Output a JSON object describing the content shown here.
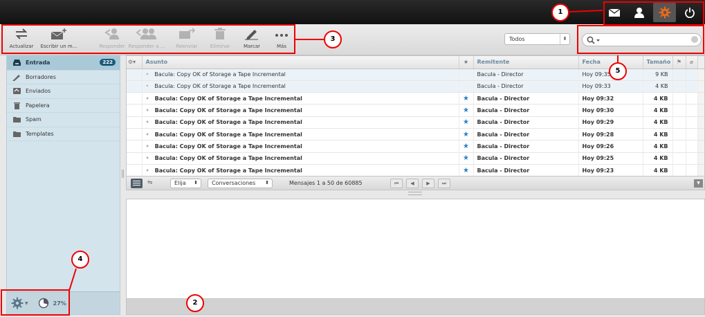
{
  "toolbar": {
    "buttons": [
      {
        "label": "Actualizar",
        "icon": "refresh-icon"
      },
      {
        "label": "Escribir un m...",
        "icon": "compose-icon"
      },
      {
        "label": "Responder",
        "icon": "reply-icon"
      },
      {
        "label": "Responder a ...",
        "icon": "reply-all-icon"
      },
      {
        "label": "Reenviar",
        "icon": "forward-icon"
      },
      {
        "label": "Eliminar",
        "icon": "trash-icon"
      },
      {
        "label": "Marcar",
        "icon": "pencil-icon"
      },
      {
        "label": "Más",
        "icon": "more-icon"
      }
    ],
    "filter_value": "Todos",
    "search_placeholder": ""
  },
  "sidebar": {
    "folders": [
      {
        "label": "Entrada",
        "icon": "inbox-icon",
        "count": "222"
      },
      {
        "label": "Borradores",
        "icon": "pencil-icon"
      },
      {
        "label": "Enviados",
        "icon": "sent-icon"
      },
      {
        "label": "Papelera",
        "icon": "trash-icon"
      },
      {
        "label": "Spam",
        "icon": "folder-icon"
      },
      {
        "label": "Templates",
        "icon": "folder-icon"
      }
    ],
    "quota": "27%"
  },
  "list": {
    "columns": {
      "subject": "Asunto",
      "from": "Remitente",
      "date": "Fecha",
      "size": "Tamaño"
    },
    "rows": [
      {
        "subject": "Bacula: Copy OK of Storage a Tape Incremental",
        "from": "Bacula - Director",
        "date": "Hoy 09:35",
        "size": "9 KB",
        "unread": false,
        "flagged": false
      },
      {
        "subject": "Bacula: Copy OK of Storage a Tape Incremental",
        "from": "Bacula - Director",
        "date": "Hoy 09:33",
        "size": "4 KB",
        "unread": false,
        "flagged": false
      },
      {
        "subject": "Bacula: Copy OK of Storage a Tape Incremental",
        "from": "Bacula - Director",
        "date": "Hoy 09:32",
        "size": "4 KB",
        "unread": true,
        "flagged": true
      },
      {
        "subject": "Bacula: Copy OK of Storage a Tape Incremental",
        "from": "Bacula - Director",
        "date": "Hoy 09:30",
        "size": "4 KB",
        "unread": true,
        "flagged": true
      },
      {
        "subject": "Bacula: Copy OK of Storage a Tape Incremental",
        "from": "Bacula - Director",
        "date": "Hoy 09:29",
        "size": "4 KB",
        "unread": true,
        "flagged": true
      },
      {
        "subject": "Bacula: Copy OK of Storage a Tape Incremental",
        "from": "Bacula - Director",
        "date": "Hoy 09:28",
        "size": "4 KB",
        "unread": true,
        "flagged": true
      },
      {
        "subject": "Bacula: Copy OK of Storage a Tape Incremental",
        "from": "Bacula - Director",
        "date": "Hoy 09:26",
        "size": "4 KB",
        "unread": true,
        "flagged": true
      },
      {
        "subject": "Bacula: Copy OK of Storage a Tape Incremental",
        "from": "Bacula - Director",
        "date": "Hoy 09:25",
        "size": "4 KB",
        "unread": true,
        "flagged": true
      },
      {
        "subject": "Bacula: Copy OK of Storage a Tape Incremental",
        "from": "Bacula - Director",
        "date": "Hoy 09:23",
        "size": "4 KB",
        "unread": true,
        "flagged": true
      }
    ]
  },
  "listfooter": {
    "select_label": "Elija",
    "threads_label": "Conversaciones",
    "count_text": "Mensajes 1 a 50 de 60885"
  },
  "annotations": [
    "1",
    "2",
    "3",
    "4",
    "5"
  ],
  "colors": {
    "annotation": "#ee0000",
    "settings_orange": "#e86a1a",
    "flag_star": "#2a7fc1"
  }
}
